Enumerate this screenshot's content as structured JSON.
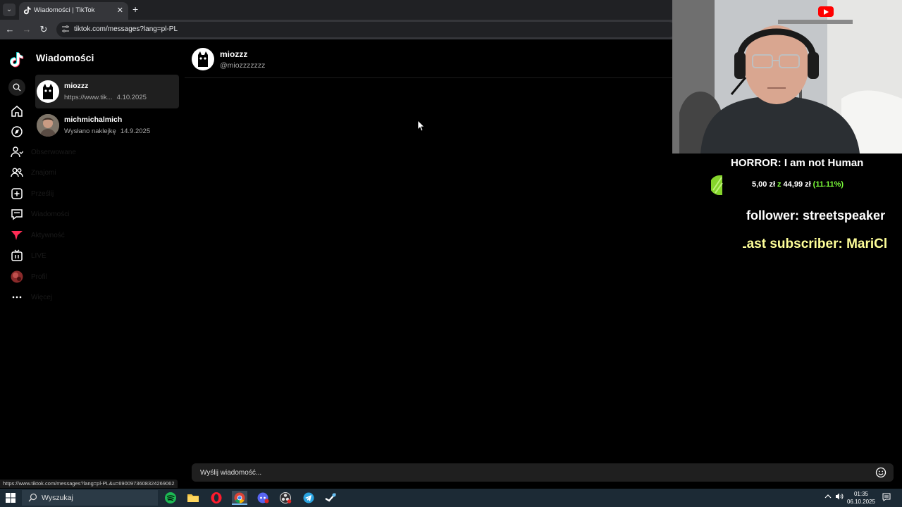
{
  "browser": {
    "tab_title": "Wiadomości | TikTok",
    "tab_close": "✕",
    "new_tab": "+",
    "url": "tiktok.com/messages?lang=pl-PL",
    "status_url": "https://www.tiktok.com/messages?lang=pl-PL&u=6900973608324269062"
  },
  "sidebar": {
    "title": "Wiadomości",
    "nav_items": [
      {
        "icon": "search-icon",
        "label": ""
      },
      {
        "icon": "home-icon",
        "label": ""
      },
      {
        "icon": "explore-icon",
        "label": ""
      },
      {
        "icon": "following-icon",
        "label": "Obserwowane"
      },
      {
        "icon": "friends-icon",
        "label": "Znajomi"
      },
      {
        "icon": "upload-icon",
        "label": "Prześlij"
      },
      {
        "icon": "messages-icon",
        "label": "Wiadomości"
      },
      {
        "icon": "activity-icon",
        "label": "Aktywność"
      },
      {
        "icon": "live-icon",
        "label": "LIVE"
      },
      {
        "icon": "profile-icon",
        "label": "Profil"
      },
      {
        "icon": "more-icon",
        "label": "Więcej"
      }
    ]
  },
  "conversations": [
    {
      "name": "miozzz",
      "preview": "https://www.tik...",
      "date": "4.10.2025",
      "active": true
    },
    {
      "name": "michmichalmich",
      "preview": "Wysłano naklejkę",
      "date": "14.9.2025",
      "active": false
    }
  ],
  "chat": {
    "name": "miozzz",
    "handle": "@miozzzzzzz",
    "composer_placeholder": "Wyślij wiadomość..."
  },
  "overlay": {
    "game_title": "HORROR: I am not Human",
    "goal_current": "5,00 zł",
    "goal_sep": "z",
    "goal_target": "44,99 zł",
    "goal_percent": "(11.11%)",
    "goal_fraction": 0.1111,
    "follower_line": "follower: streetspeaker",
    "subscriber_line": "Last subscriber: MariCl"
  },
  "taskbar": {
    "search_label": "Wyszukaj",
    "time": "01:35",
    "date": "06.10.2025",
    "apps": [
      "spotify-icon",
      "file-explorer-icon",
      "opera-icon",
      "chrome-icon",
      "app-icon",
      "obs-icon",
      "telegram-icon",
      "steam-icon"
    ]
  },
  "colors": {
    "accent_green": "#7cff3a",
    "subscriber_yellow": "#ffff99",
    "tiktok_red": "#fe2c55",
    "youtube_red": "#ff0000"
  }
}
